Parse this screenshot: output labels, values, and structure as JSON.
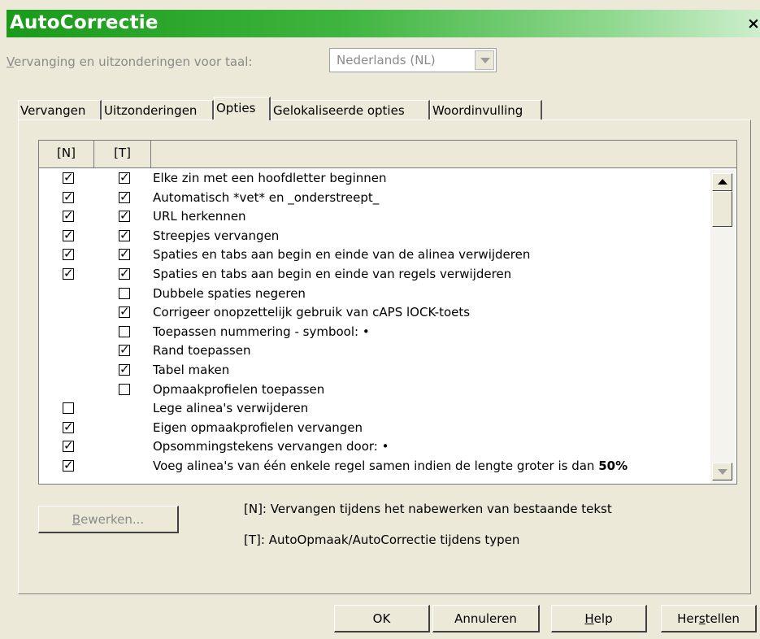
{
  "window": {
    "title": "AutoCorrectie",
    "close_glyph": "×"
  },
  "language": {
    "label_prefix": "V",
    "label_rest": "ervanging en uitzonderingen voor taal:",
    "selected": "Nederlands (NL)"
  },
  "tabs": [
    {
      "label": "Vervangen"
    },
    {
      "label": "Uitzonderingen"
    },
    {
      "label": "Opties",
      "active": true
    },
    {
      "label": "Gelokaliseerde opties"
    },
    {
      "label": "Woordinvulling"
    }
  ],
  "options_table": {
    "col_n": "[N]",
    "col_t": "[T]",
    "rows": [
      {
        "n": true,
        "t": true,
        "label": "Elke zin met een hoofdletter beginnen"
      },
      {
        "n": true,
        "t": true,
        "label": "Automatisch *vet* en _onderstreept_"
      },
      {
        "n": true,
        "t": true,
        "label": "URL herkennen"
      },
      {
        "n": true,
        "t": true,
        "label": "Streepjes vervangen"
      },
      {
        "n": true,
        "t": true,
        "label": "Spaties en tabs aan begin en einde van de alinea verwijderen"
      },
      {
        "n": true,
        "t": true,
        "label": "Spaties en tabs aan begin en einde van regels verwijderen"
      },
      {
        "n": null,
        "t": false,
        "label": "Dubbele spaties negeren"
      },
      {
        "n": null,
        "t": true,
        "label": "Corrigeer onopzettelijk gebruik van cAPS lOCK-toets"
      },
      {
        "n": null,
        "t": false,
        "label": "Toepassen nummering - symbool: •"
      },
      {
        "n": null,
        "t": true,
        "label": "Rand toepassen"
      },
      {
        "n": null,
        "t": true,
        "label": "Tabel maken"
      },
      {
        "n": null,
        "t": false,
        "label": "Opmaakprofielen toepassen"
      },
      {
        "n": false,
        "t": null,
        "label": "Lege alinea's verwijderen"
      },
      {
        "n": true,
        "t": null,
        "label": "Eigen opmaakprofielen vervangen"
      },
      {
        "n": true,
        "t": null,
        "label": "Opsommingstekens vervangen door: •"
      },
      {
        "n": true,
        "t": null,
        "label": "Voeg alinea's van één enkele regel samen indien de lengte groter is dan ",
        "bold_suffix": "50%"
      }
    ]
  },
  "edit_button": {
    "prefix": "B",
    "rest": "ewerken..."
  },
  "legend": {
    "n": "[N]: Vervangen tijdens het nabewerken van bestaande tekst",
    "t": "[T]: AutoOpmaak/AutoCorrectie tijdens typen"
  },
  "footer": {
    "ok": "OK",
    "cancel": "Annuleren",
    "help_prefix": "H",
    "help_rest": "elp",
    "reset_a": "Her",
    "reset_u": "s",
    "reset_b": "tellen"
  },
  "colors": {
    "title_gradient_start": "#1a9a1a",
    "title_gradient_end": "#cdeecd",
    "dialog_bg": "#ece9d8"
  }
}
